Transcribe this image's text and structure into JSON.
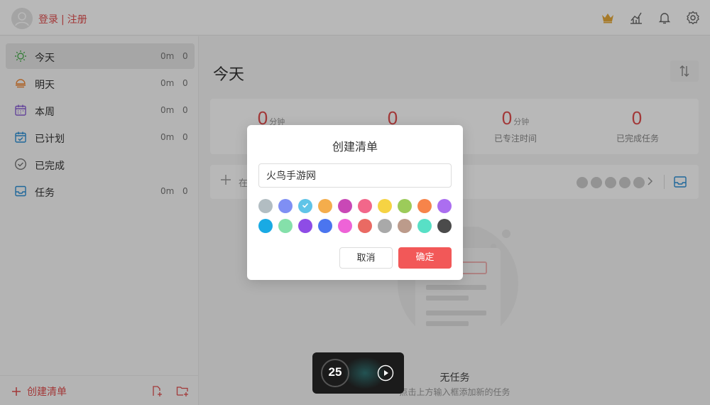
{
  "header": {
    "login_label": "登录",
    "separator": "|",
    "register_label": "注册",
    "icons": [
      "crown-icon",
      "stats-icon",
      "bell-icon",
      "settings-icon"
    ]
  },
  "sidebar": {
    "items": [
      {
        "label": "今天",
        "time": "0m",
        "count": "0",
        "icon": "sun-icon",
        "active": true
      },
      {
        "label": "明天",
        "time": "0m",
        "count": "0",
        "icon": "sunrise-icon"
      },
      {
        "label": "本周",
        "time": "0m",
        "count": "0",
        "icon": "calendar-week-icon"
      },
      {
        "label": "已计划",
        "time": "0m",
        "count": "0",
        "icon": "calendar-planned-icon"
      },
      {
        "label": "已完成",
        "time": "",
        "count": "",
        "icon": "check-circle-icon"
      },
      {
        "label": "任务",
        "time": "0m",
        "count": "0",
        "icon": "inbox-icon"
      }
    ],
    "create_list_label": "创建清单"
  },
  "main": {
    "title": "今天",
    "stats": [
      {
        "value": "0",
        "unit": "分钟",
        "label": ""
      },
      {
        "value": "0",
        "unit": "",
        "label": ""
      },
      {
        "value": "0",
        "unit": "分钟",
        "label": "已专注时间"
      },
      {
        "value": "0",
        "unit": "",
        "label": "已完成任务"
      }
    ],
    "add_task_placeholder": "在",
    "empty_title": "无任务",
    "empty_subtitle": "点击上方输入框添加新的任务"
  },
  "dialog": {
    "title": "创建清单",
    "input_value": "火鸟手游网",
    "colors": [
      "#b2bdc2",
      "#7f8ff4",
      "#5fc4e8",
      "#f4ad4c",
      "#c948b6",
      "#f2678a",
      "#f6d343",
      "#9ccb5a",
      "#f7844a",
      "#ab6ef0",
      "#19aae4",
      "#85e0aa",
      "#8e4ce6",
      "#4b75ef",
      "#ee63d7",
      "#ea6a63",
      "#a9a9a9",
      "#bc9b8b",
      "#58e0c6",
      "#4b4b4b"
    ],
    "selected_color_index": 2,
    "cancel_label": "取消",
    "confirm_label": "确定"
  },
  "pomodoro": {
    "minutes": "25"
  }
}
